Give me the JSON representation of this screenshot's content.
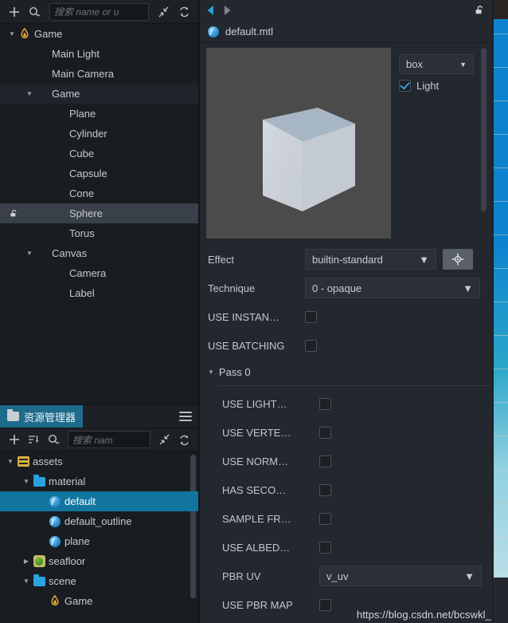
{
  "hierarchy": {
    "toolbar": {
      "add_label": "+",
      "search_icon": "search-icon",
      "search_placeholder": "搜索 name or u",
      "collapse_label": "collapse-icon",
      "refresh_label": "refresh-icon"
    },
    "nodes": [
      {
        "label": "Game",
        "depth": 0,
        "arrow": "down",
        "icon": "flame",
        "selected": false,
        "locked": false
      },
      {
        "label": "Main Light",
        "depth": 1,
        "arrow": "",
        "icon": "none",
        "selected": false,
        "locked": false
      },
      {
        "label": "Main Camera",
        "depth": 1,
        "arrow": "",
        "icon": "none",
        "selected": false,
        "locked": false
      },
      {
        "label": "Game",
        "depth": 1,
        "arrow": "down",
        "icon": "none",
        "selected": false,
        "locked": false,
        "alt": true
      },
      {
        "label": "Plane",
        "depth": 2,
        "arrow": "",
        "icon": "none",
        "selected": false,
        "locked": false
      },
      {
        "label": "Cylinder",
        "depth": 2,
        "arrow": "",
        "icon": "none",
        "selected": false,
        "locked": false
      },
      {
        "label": "Cube",
        "depth": 2,
        "arrow": "",
        "icon": "none",
        "selected": false,
        "locked": false
      },
      {
        "label": "Capsule",
        "depth": 2,
        "arrow": "",
        "icon": "none",
        "selected": false,
        "locked": false
      },
      {
        "label": "Cone",
        "depth": 2,
        "arrow": "",
        "icon": "none",
        "selected": false,
        "locked": false
      },
      {
        "label": "Sphere",
        "depth": 2,
        "arrow": "",
        "icon": "none",
        "selected": true,
        "locked": true
      },
      {
        "label": "Torus",
        "depth": 2,
        "arrow": "",
        "icon": "none",
        "selected": false,
        "locked": false
      },
      {
        "label": "Canvas",
        "depth": 1,
        "arrow": "down",
        "icon": "none",
        "selected": false,
        "locked": false
      },
      {
        "label": "Camera",
        "depth": 2,
        "arrow": "",
        "icon": "none",
        "selected": false,
        "locked": false
      },
      {
        "label": "Label",
        "depth": 2,
        "arrow": "",
        "icon": "none",
        "selected": false,
        "locked": false
      }
    ]
  },
  "assets": {
    "tab_label": "资源管理器",
    "tab_icon": "folder-icon",
    "menu_icon": "hamburger-icon",
    "toolbar": {
      "add_label": "+",
      "sort_icon": "sort-icon",
      "search_icon": "search-icon",
      "search_placeholder": "搜索 nam",
      "collapse_label": "collapse-icon",
      "refresh_label": "refresh-icon"
    },
    "nodes": [
      {
        "label": "assets",
        "depth": 0,
        "arrow": "down",
        "icon": "assets",
        "selected": false
      },
      {
        "label": "material",
        "depth": 1,
        "arrow": "down",
        "icon": "folder",
        "selected": false
      },
      {
        "label": "default",
        "depth": 2,
        "arrow": "",
        "icon": "mat",
        "selected": true
      },
      {
        "label": "default_outline",
        "depth": 2,
        "arrow": "",
        "icon": "mat",
        "selected": false
      },
      {
        "label": "plane",
        "depth": 2,
        "arrow": "",
        "icon": "mat",
        "selected": false
      },
      {
        "label": "seafloor",
        "depth": 1,
        "arrow": "right",
        "icon": "tex",
        "selected": false
      },
      {
        "label": "scene",
        "depth": 1,
        "arrow": "down",
        "icon": "folder",
        "selected": false
      },
      {
        "label": "Game",
        "depth": 2,
        "arrow": "",
        "icon": "flame",
        "selected": false
      }
    ]
  },
  "inspector": {
    "nav": {
      "back_icon": "arrow-left-icon",
      "forward_icon": "arrow-right-icon",
      "lock_icon": "unlock-icon"
    },
    "asset_name": "default.mtl",
    "asset_icon": "material-icon",
    "preview": {
      "shape_value": "box",
      "shape_caret": "▼",
      "light_label": "Light",
      "light_checked": true
    },
    "properties": [
      {
        "label": "Effect",
        "type": "select",
        "value": "builtin-standard",
        "has_locate": true
      },
      {
        "label": "Technique",
        "type": "select",
        "value": "0 - opaque",
        "has_locate": false
      },
      {
        "label": "USE INSTAN…",
        "type": "checkbox",
        "checked": false
      },
      {
        "label": "USE BATCHING",
        "type": "checkbox",
        "checked": false
      }
    ],
    "pass": {
      "title": "Pass 0",
      "properties": [
        {
          "label": "USE LIGHT…",
          "type": "checkbox",
          "checked": false
        },
        {
          "label": "USE VERTE…",
          "type": "checkbox",
          "checked": false
        },
        {
          "label": "USE NORM…",
          "type": "checkbox",
          "checked": false
        },
        {
          "label": "HAS SECO…",
          "type": "checkbox",
          "checked": false
        },
        {
          "label": "SAMPLE FR…",
          "type": "checkbox",
          "checked": false
        },
        {
          "label": "USE ALBED…",
          "type": "checkbox",
          "checked": false
        },
        {
          "label": "PBR UV",
          "type": "select",
          "value": "v_uv"
        },
        {
          "label": "USE PBR MAP",
          "type": "checkbox",
          "checked": false
        }
      ]
    }
  },
  "watermark": "https://blog.csdn.net/bcswkl_",
  "colors": {
    "accent": "#1275a0",
    "tab_accent": "#1d6b8a",
    "panel_bg": "#191c21",
    "inspector_bg": "#23272e",
    "selected_row": "#3a4049"
  }
}
